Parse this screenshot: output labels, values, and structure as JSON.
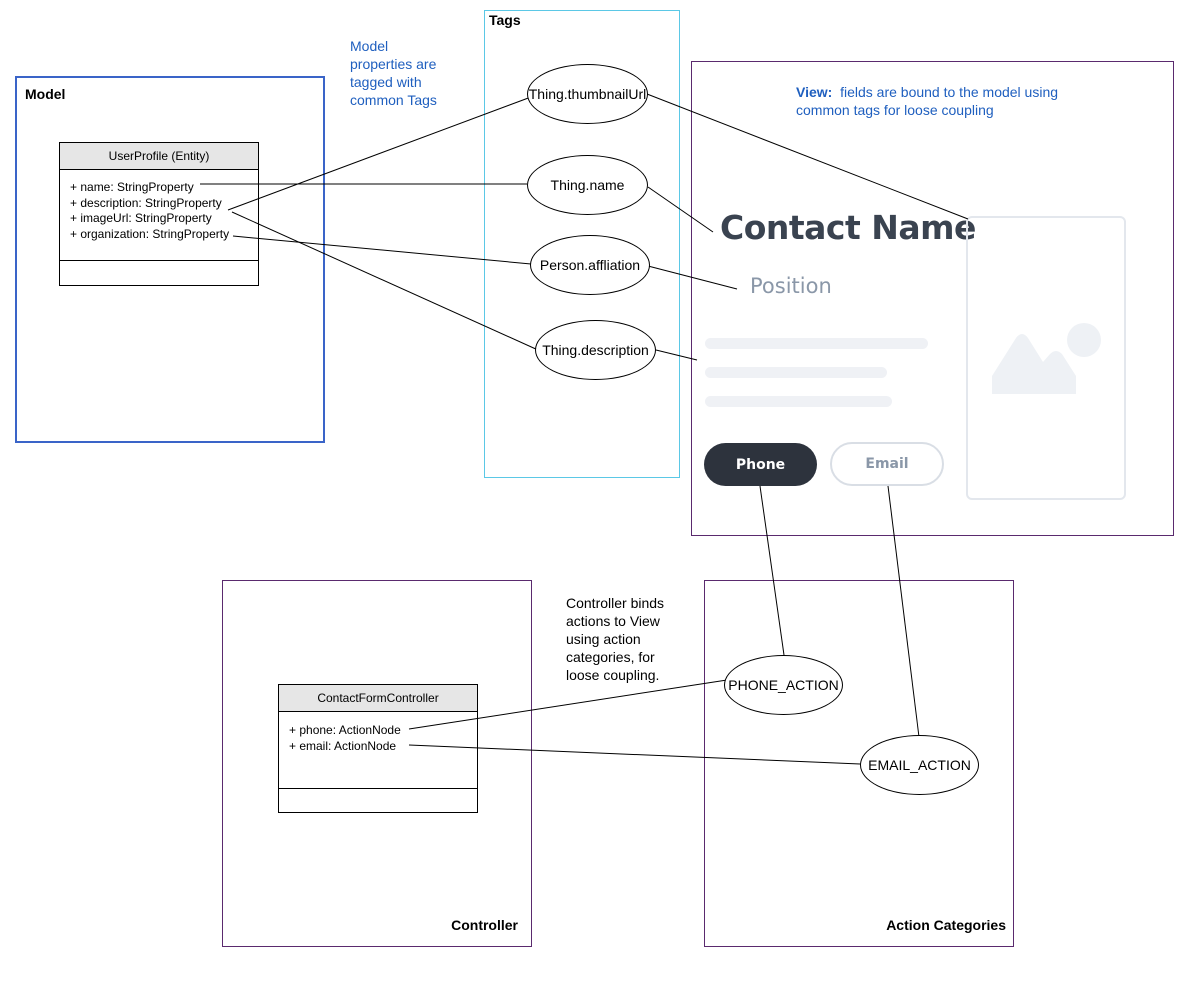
{
  "model": {
    "title": "Model",
    "note": [
      "Model",
      "properties are",
      "tagged with",
      "common Tags"
    ],
    "entity": {
      "name": "UserProfile (Entity)",
      "attributes": [
        "+ name: StringProperty",
        "+ description: StringProperty",
        "+ imageUrl: StringProperty",
        "+ organization: StringProperty"
      ]
    }
  },
  "tags": {
    "title": "Tags",
    "items": [
      "Thing.thumbnailUrl",
      "Thing.name",
      "Person.affliation",
      "Thing.description"
    ]
  },
  "view": {
    "note_label": "View:",
    "note_text_1": "fields are bound to the model using",
    "note_text_2": "common tags for loose coupling",
    "contact_name": "Contact Name",
    "position": "Position",
    "phone_button": "Phone",
    "email_button": "Email"
  },
  "controller": {
    "title": "Controller",
    "note": [
      "Controller binds",
      "actions to View",
      "using action",
      "categories, for",
      "loose coupling."
    ],
    "class": {
      "name": "ContactFormController",
      "attributes": [
        "+ phone: ActionNode",
        "+ email: ActionNode"
      ]
    }
  },
  "action_categories": {
    "title": "Action Categories",
    "items": [
      "PHONE_ACTION",
      "EMAIL_ACTION"
    ]
  },
  "colors": {
    "model_border": "#3a64c8",
    "tags_border": "#5bc8e6",
    "view_border": "#5a2a6e",
    "note_blue": "#1f5fbf",
    "dark_button": "#2d333d",
    "muted_text": "#8a97a8"
  }
}
